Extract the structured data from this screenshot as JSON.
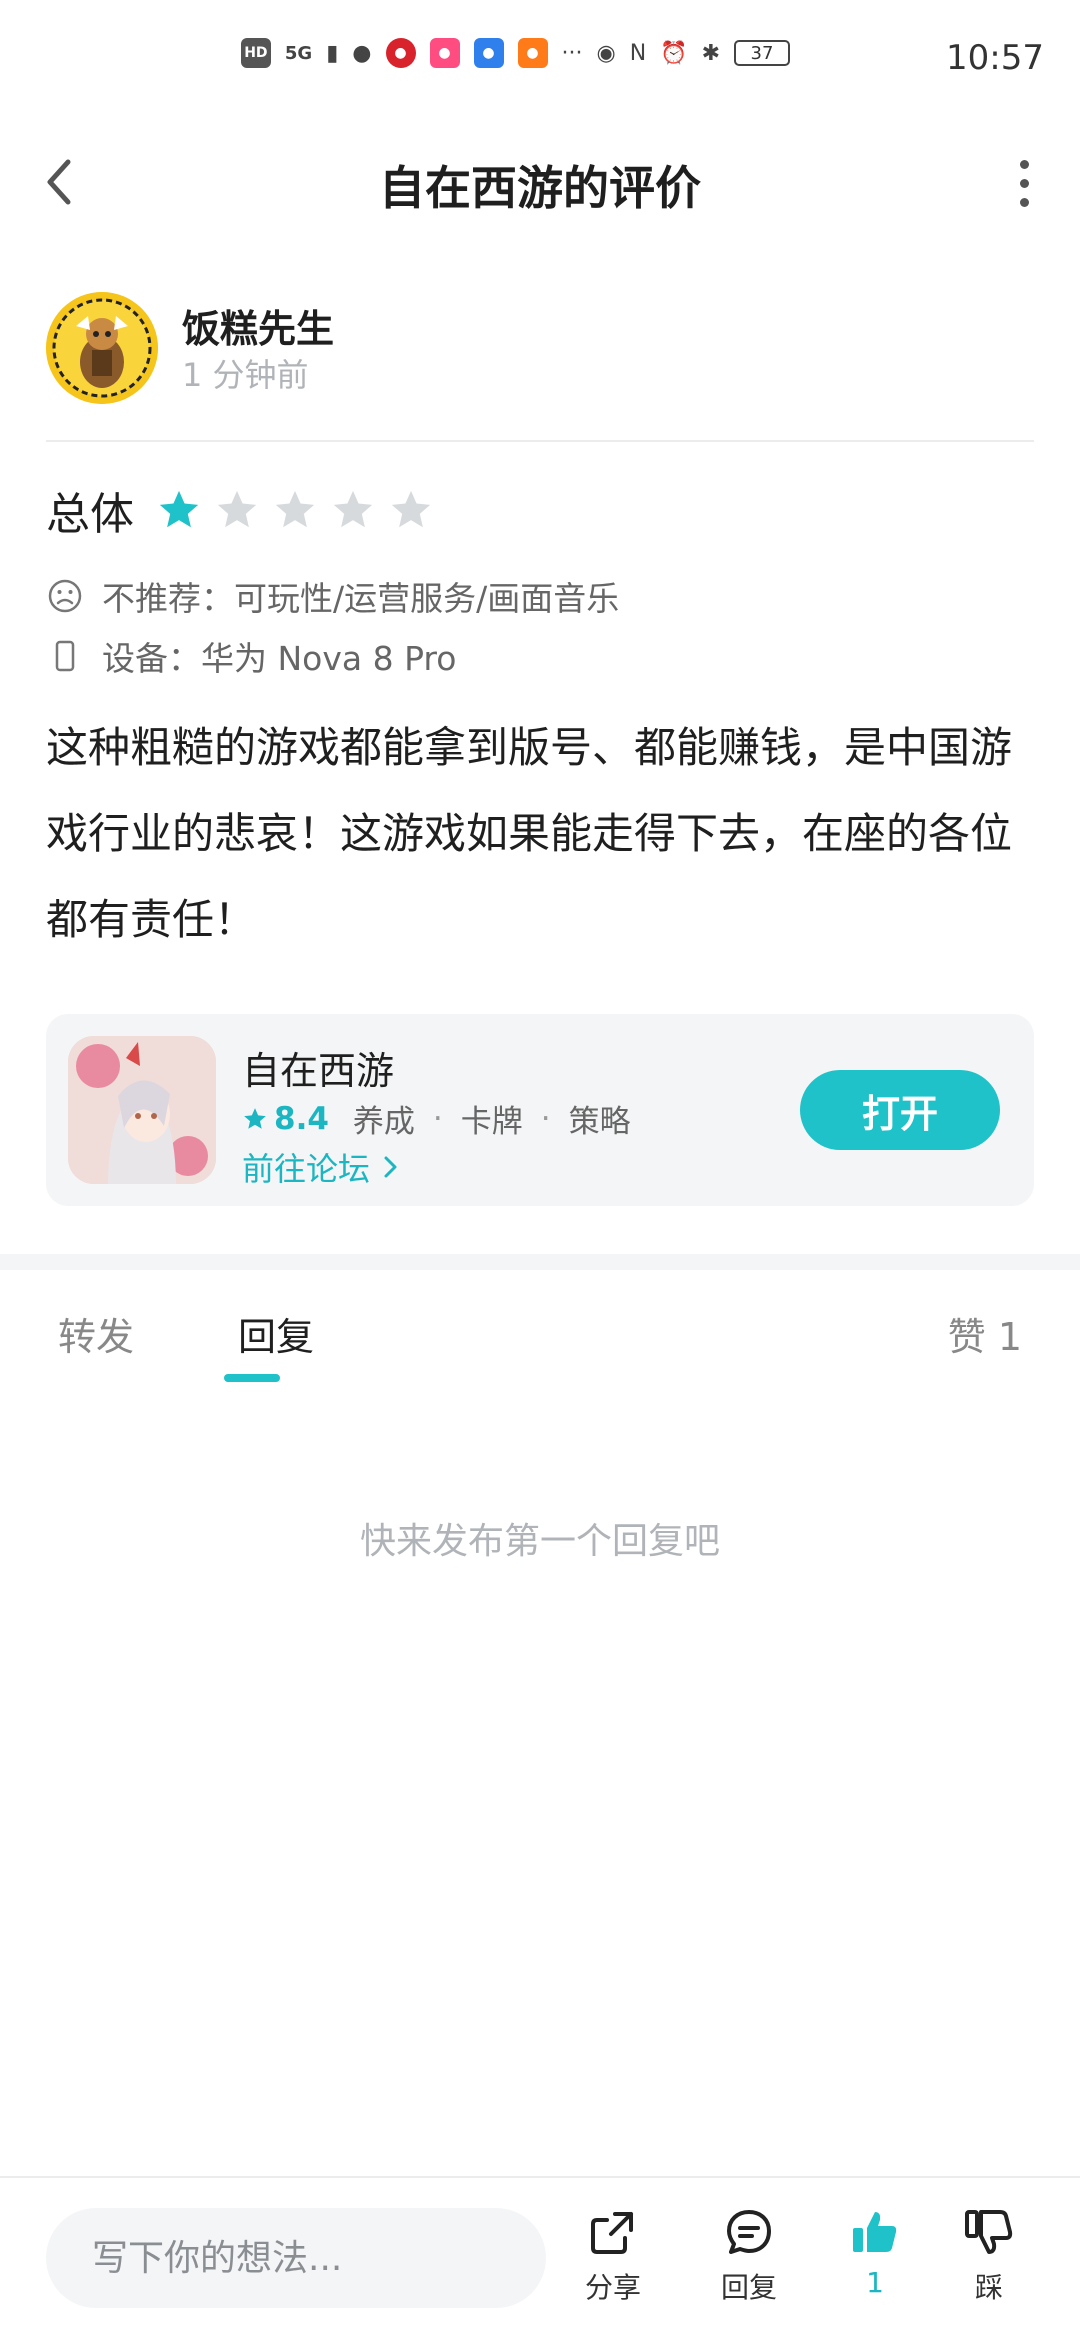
{
  "status_bar": {
    "time": "10:57",
    "battery": "37",
    "network": "5G",
    "hd": "HD",
    "more": "···"
  },
  "header": {
    "title": "自在西游的评价"
  },
  "author": {
    "name": "饭糕先生",
    "time": "1 分钟前"
  },
  "rating": {
    "label": "总体",
    "stars": 1,
    "max_stars": 5,
    "accent": "#1fc2c8",
    "empty": "#d7dadd"
  },
  "meta": {
    "not_recommend": "不推荐：可玩性/运营服务/画面音乐",
    "device": "设备：华为 Nova 8 Pro"
  },
  "review": {
    "text": "这种粗糙的游戏都能拿到版号、都能赚钱，是中国游戏行业的悲哀！这游戏如果能走得下去，在座的各位都有责任！"
  },
  "game_card": {
    "name": "自在西游",
    "score": "8.4",
    "tags": [
      "养成",
      "卡牌",
      "策略"
    ],
    "forum_link": "前往论坛",
    "open_button": "打开"
  },
  "tabs": {
    "forward": "转发",
    "reply": "回复",
    "like_label": "赞 1"
  },
  "empty_state": {
    "text": "快来发布第一个回复吧"
  },
  "bottom_bar": {
    "input_placeholder": "写下你的想法...",
    "share": "分享",
    "reply": "回复",
    "like_count": "1",
    "dislike": "踩"
  }
}
